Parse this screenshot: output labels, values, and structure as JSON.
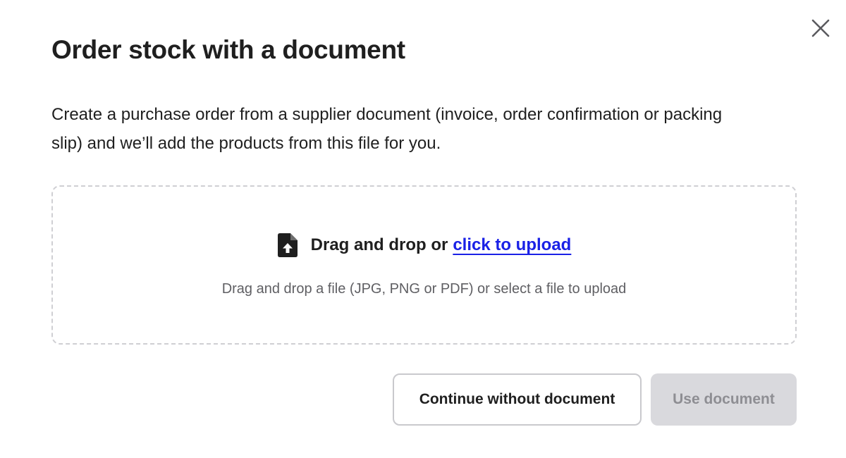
{
  "dialog": {
    "title": "Order stock with a document",
    "description": "Create a purchase order from a supplier document (invoice, order confirmation or packing slip) and we’ll add the products from this file for you.",
    "close_icon": "close-icon"
  },
  "dropzone": {
    "icon": "file-upload-icon",
    "lead_text": "Drag and drop or",
    "link_text": "click to upload",
    "hint": "Drag and drop a file (JPG, PNG or PDF) or select a file to upload",
    "link_color": "#1a21e6"
  },
  "actions": {
    "secondary_label": "Continue without document",
    "primary_label": "Use document",
    "primary_disabled": true
  }
}
